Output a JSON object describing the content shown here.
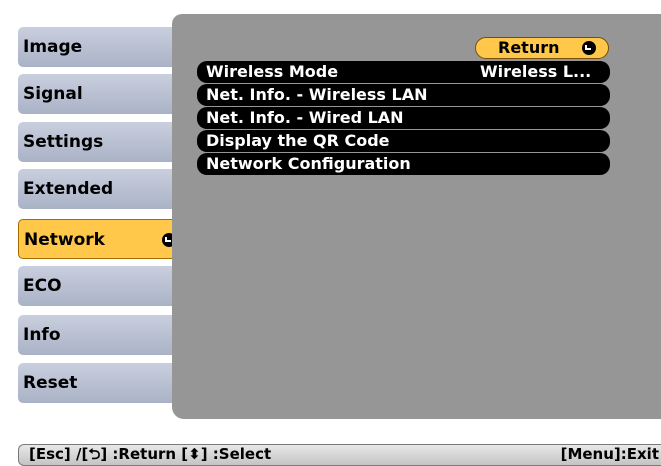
{
  "sidebar": {
    "items": [
      {
        "label": "Image"
      },
      {
        "label": "Signal"
      },
      {
        "label": "Settings"
      },
      {
        "label": "Extended"
      },
      {
        "label": "Network",
        "selected": true
      },
      {
        "label": "ECO"
      },
      {
        "label": "Info"
      },
      {
        "label": "Reset"
      }
    ]
  },
  "panel": {
    "return_label": "Return",
    "options": [
      {
        "label": "Wireless Mode",
        "value": "Wireless L..."
      },
      {
        "label": "Net. Info. - Wireless LAN"
      },
      {
        "label": "Net. Info. - Wired LAN"
      },
      {
        "label": "Display the QR Code"
      },
      {
        "label": "Network Configuration"
      }
    ]
  },
  "footer": {
    "left_text": "[Esc] /[⮌] :Return  [⬍] :Select",
    "right_text": "[Menu]:Exit"
  },
  "colors": {
    "accent": "#ffc84a",
    "panel_bg": "#969696",
    "menu_bg": "#000000"
  },
  "icons": {
    "enter": "enter-icon",
    "up_down": "up-down-arrow-icon"
  }
}
